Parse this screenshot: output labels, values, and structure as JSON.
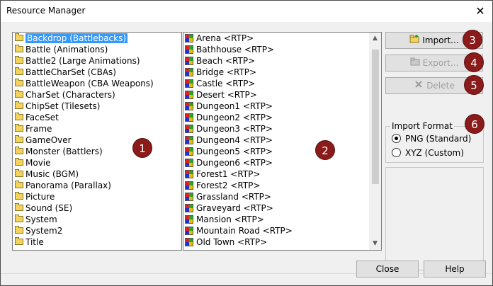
{
  "window": {
    "title": "Resource Manager",
    "close_glyph": "✕"
  },
  "categories": [
    "Backdrop (Battlebacks)",
    "Battle (Animations)",
    "Battle2 (Large Animations)",
    "BattleCharSet (CBAs)",
    "BattleWeapon (CBA Weapons)",
    "CharSet (Characters)",
    "ChipSet (Tilesets)",
    "FaceSet",
    "Frame",
    "GameOver",
    "Monster (Battlers)",
    "Movie",
    "Music (BGM)",
    "Panorama (Parallax)",
    "Picture",
    "Sound (SE)",
    "System",
    "System2",
    "Title"
  ],
  "selected_category": "Backdrop (Battlebacks)",
  "files": [
    "Arena <RTP>",
    "Bathhouse <RTP>",
    "Beach <RTP>",
    "Bridge <RTP>",
    "Castle <RTP>",
    "Desert <RTP>",
    "Dungeon1 <RTP>",
    "Dungeon2 <RTP>",
    "Dungeon3 <RTP>",
    "Dungeon4 <RTP>",
    "Dungeon5 <RTP>",
    "Dungeon6 <RTP>",
    "Forest1 <RTP>",
    "Forest2 <RTP>",
    "Grassland <RTP>",
    "Graveyard <RTP>",
    "Mansion <RTP>",
    "Mountain Road <RTP>",
    "Old Town <RTP>"
  ],
  "buttons": {
    "import": {
      "label": "Import...",
      "icon": "folder-add-icon"
    },
    "export": {
      "label": "Export...",
      "icon": "export-icon"
    },
    "delete": {
      "label": "Delete",
      "icon": "delete-x-icon"
    }
  },
  "import_format": {
    "legend": "Import Format",
    "options": [
      {
        "label": "PNG (Standard)",
        "checked": true
      },
      {
        "label": "XYZ (Custom)",
        "checked": false
      }
    ]
  },
  "badges": [
    "1",
    "2",
    "3",
    "4",
    "5",
    "6"
  ],
  "footer": {
    "close_label": "Close",
    "help_label": "Help"
  },
  "colors": {
    "selection": "#3399ff",
    "badge": "#8b1a1a"
  }
}
